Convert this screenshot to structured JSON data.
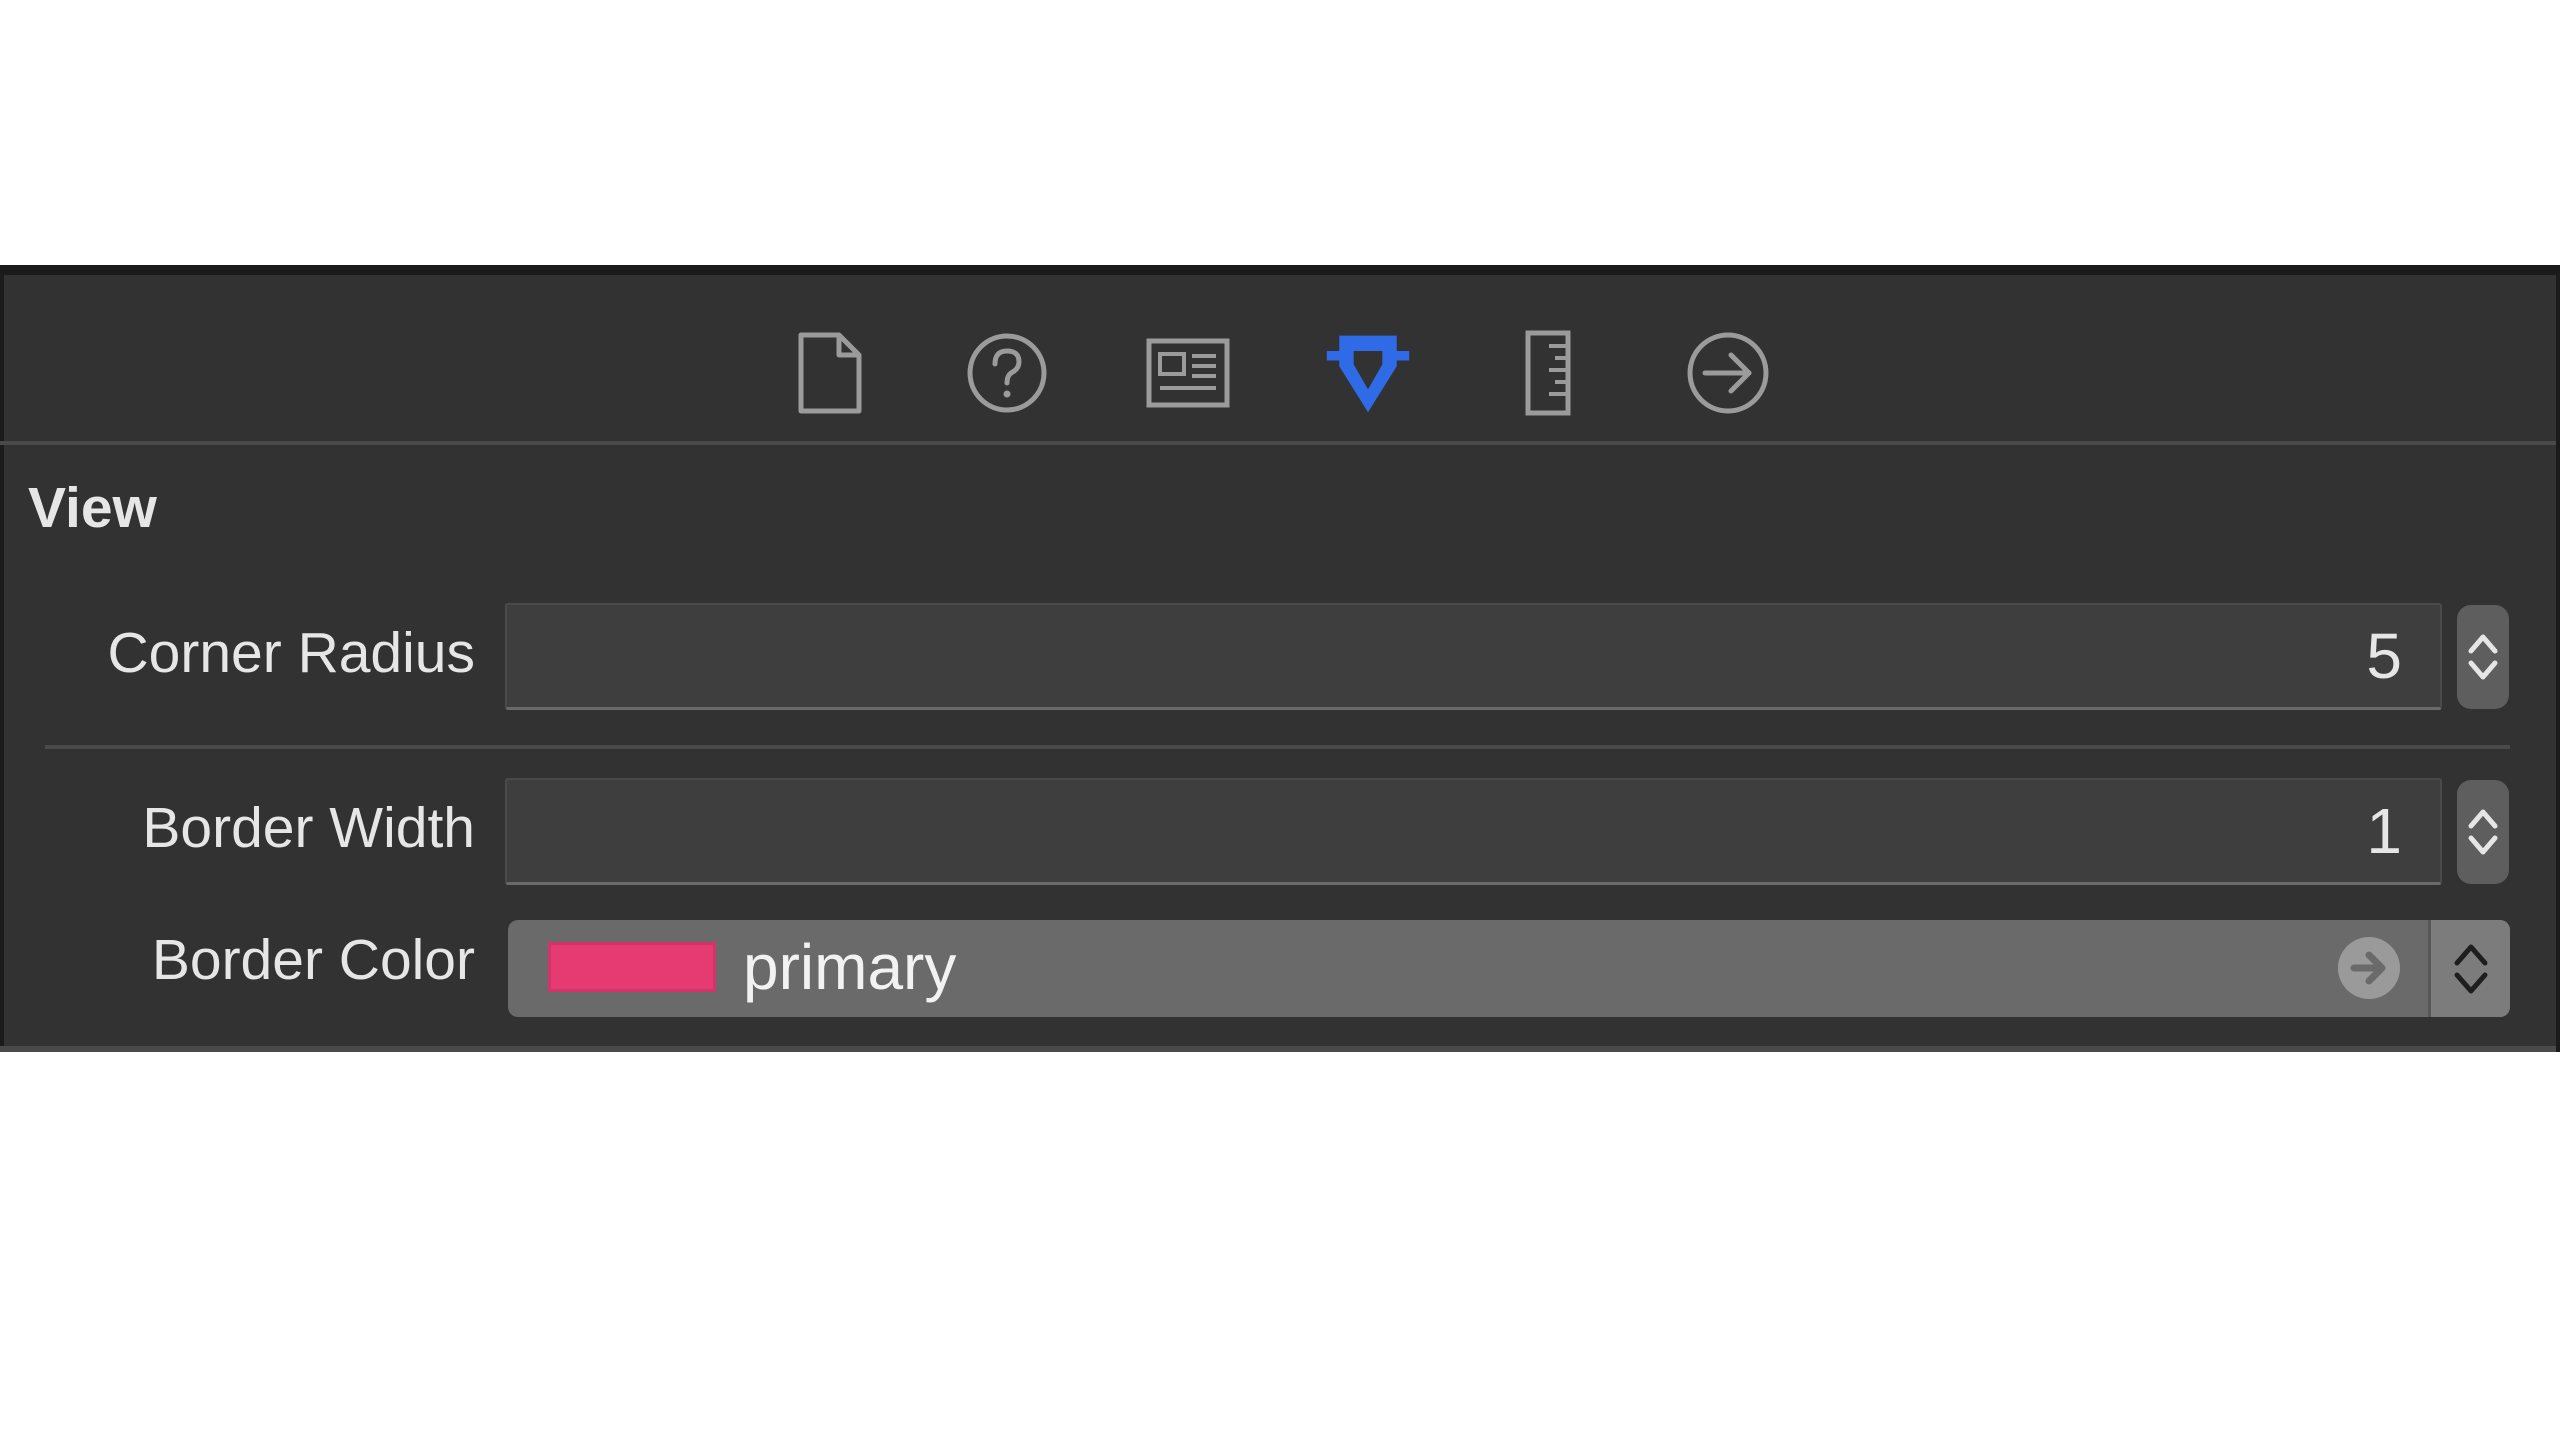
{
  "toolbar": {
    "tabs": [
      {
        "icon": "file-icon",
        "label": "File Inspector"
      },
      {
        "icon": "quick-help-icon",
        "label": "Quick Help Inspector"
      },
      {
        "icon": "identity-icon",
        "label": "Identity Inspector"
      },
      {
        "icon": "attributes-icon",
        "label": "Attributes Inspector",
        "selected": true
      },
      {
        "icon": "size-icon",
        "label": "Size Inspector"
      },
      {
        "icon": "connections-icon",
        "label": "Connections Inspector"
      }
    ],
    "accent_color": "#2f6be6",
    "icon_color": "#9b9b9b"
  },
  "section": {
    "title": "View"
  },
  "properties": {
    "corner_radius": {
      "label": "Corner Radius",
      "value": "5"
    },
    "border_width": {
      "label": "Border Width",
      "value": "1"
    },
    "border_color": {
      "label": "Border Color",
      "value": "primary",
      "swatch": "#e63a73"
    }
  }
}
